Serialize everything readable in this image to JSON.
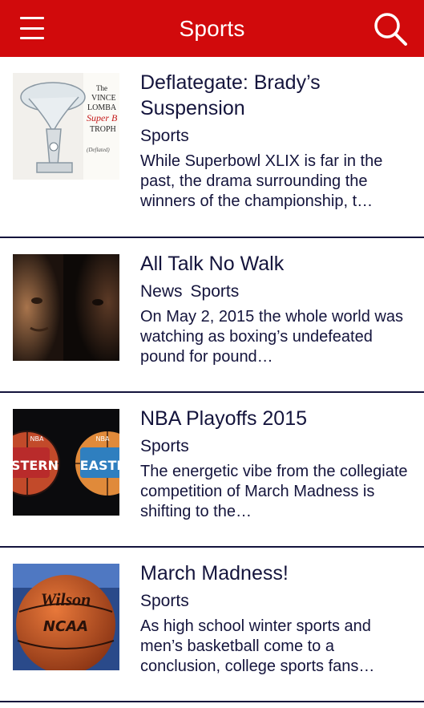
{
  "header": {
    "title": "Sports",
    "menu_icon": "hamburger-menu-icon",
    "search_icon": "search-icon",
    "background_color": "#d10a0c"
  },
  "articles": [
    {
      "title": "Deflategate: Brady’s Suspension",
      "categories": [
        "Sports"
      ],
      "summary": "While Superbowl XLIX is far in the past, the drama surrounding the winners of the championship, t…"
    },
    {
      "title": "All Talk No Walk",
      "categories": [
        "News",
        "Sports"
      ],
      "summary": "On May 2, 2015 the whole world was watching as boxing’s undefeated pound for pound…"
    },
    {
      "title": "NBA Playoffs 2015",
      "categories": [
        "Sports"
      ],
      "summary": "The energetic vibe from the collegiate competition of March Madness is shifting to the…"
    },
    {
      "title": "March Madness!",
      "categories": [
        "Sports"
      ],
      "summary": "As high school winter sports and men’s basketball come to a conclusion, college sports fans…"
    }
  ]
}
